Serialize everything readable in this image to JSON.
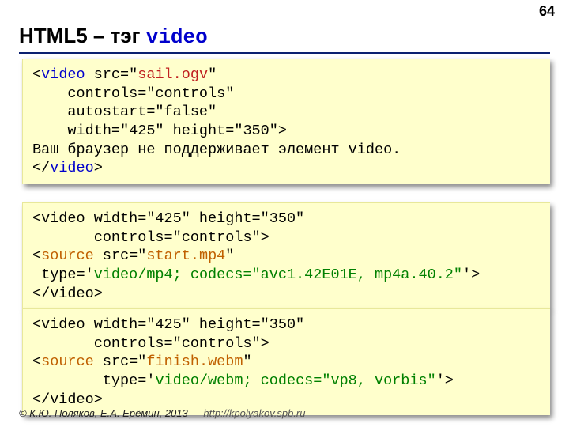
{
  "page_number": "64",
  "title": {
    "prefix": "HTML5 – тэг ",
    "tag": "video"
  },
  "box1": {
    "l1a": "<",
    "l1b": "video",
    "l1c": " src=\"",
    "l1d": "sail.ogv",
    "l1e": "\"",
    "l2": "    controls=\"controls\"",
    "l3": "    autostart=\"false\"",
    "l4": "    width=\"425\" height=\"350\">",
    "l5": "Ваш браузер не поддерживает элемент video.",
    "l6a": "</",
    "l6b": "video",
    "l6c": ">"
  },
  "box2": {
    "l1": "<video width=\"425\" height=\"350\"",
    "l2": "       controls=\"controls\">",
    "l3a": "<",
    "l3b": "source",
    "l3c": " src=\"",
    "l3d": "start.mp4",
    "l3e": "\"",
    "l4a": " type='",
    "l4b": "video/mp4; codecs=\"avc1.42E01E, mp4a.40.2\"",
    "l4c": "'>",
    "l5": "</video>"
  },
  "box3": {
    "l1": "<video width=\"425\" height=\"350\"",
    "l2": "       controls=\"controls\">",
    "l3a": "<",
    "l3b": "source",
    "l3c": " src=\"",
    "l3d": "finish.webm",
    "l3e": "\"",
    "l4a": "        type='",
    "l4b": "video/webm; codecs=\"vp8, vorbis\"",
    "l4c": "'>",
    "l5": "</video>"
  },
  "footer": {
    "copyright": "© К.Ю. Поляков, Е.А. Ерёмин, 2013",
    "url": "http://kpolyakov.spb.ru"
  }
}
